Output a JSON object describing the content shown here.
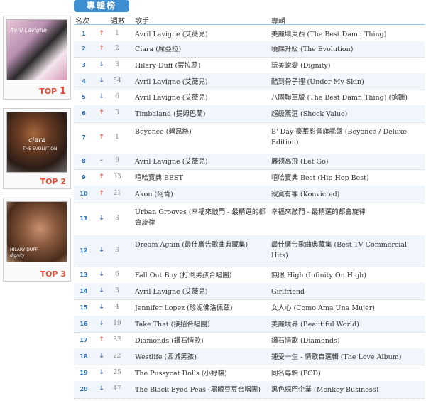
{
  "title": "專輯榜",
  "header": {
    "rank": "名次",
    "weeks": "週數",
    "artist": "歌手",
    "album": "專輯"
  },
  "sidebar": [
    {
      "cover_name": "Avril Lavigne",
      "top_label": "TOP",
      "top_num": "1"
    },
    {
      "cover_name": "ciara",
      "cover_sub": "THE EVOLUTION",
      "top_label": "TOP",
      "top_num": "2"
    },
    {
      "cover_name": "HILARY DUFF",
      "cover_sub": "dignity",
      "top_label": "TOP",
      "top_num": "3"
    }
  ],
  "arrows": {
    "up": "↑",
    "down": "↓",
    "same": "-"
  },
  "rows": [
    {
      "rank": "1",
      "move": "up",
      "weeks": "1",
      "artist": "Avril Lavigne (艾薇兒)",
      "album": "美麗壞東西 (The Best Damn Thing)"
    },
    {
      "rank": "2",
      "move": "up",
      "weeks": "2",
      "artist": "Ciara (席亞拉)",
      "album": "曉課升級 (The Evolution)"
    },
    {
      "rank": "3",
      "move": "down",
      "weeks": "3",
      "artist": "Hilary Duff (蒂拉蕊)",
      "album": "玩美蛻變 (Dignity)"
    },
    {
      "rank": "4",
      "move": "down",
      "weeks": "54",
      "artist": "Avril Lavigne (艾薇兒)",
      "album": "酷到骨子裡 (Under My Skin)"
    },
    {
      "rank": "5",
      "move": "down",
      "weeks": "6",
      "artist": "Avril Lavigne (艾薇兒)",
      "album": "八國聯軍版 (The Best Damn Thing) (搶聽)"
    },
    {
      "rank": "6",
      "move": "up",
      "weeks": "3",
      "artist": "Timbaland (提姆巴蘭)",
      "album": "超級驚選 (Shock Value)"
    },
    {
      "rank": "7",
      "move": "up",
      "weeks": "1",
      "artist": "Beyonce (碧昂絲)",
      "album": "B' Day 豪華影音旗艦盤 (Beyonce / Deluxe Edition)"
    },
    {
      "rank": "8",
      "move": "same",
      "weeks": "9",
      "artist": "Avril Lavigne (艾薇兒)",
      "album": "展翅高飛 (Let Go)"
    },
    {
      "rank": "9",
      "move": "up",
      "weeks": "33",
      "artist": "嘻哈寶典 BEST",
      "album": "嘻哈寶典 Best (Hip Hop Best)"
    },
    {
      "rank": "10",
      "move": "up",
      "weeks": "21",
      "artist": "Akon (阿肯)",
      "album": "寂寞有罪 (Konvicted)"
    },
    {
      "rank": "11",
      "move": "down",
      "weeks": "3",
      "artist": "Urban Grooves (幸福來敲門 - 最精選的都會旋律",
      "album": "幸福來敲門 - 最精選的都會旋律"
    },
    {
      "rank": "12",
      "move": "down",
      "weeks": "3",
      "artist": "Dream Again (最佳廣告歌曲典藏集)",
      "album": "最佳廣告歌曲典藏集 (Best TV Commercial Hits)"
    },
    {
      "rank": "13",
      "move": "down",
      "weeks": "6",
      "artist": "Fall Out Boy (打倒男孩合唱團)",
      "album": "無限 High (Infinity On High)"
    },
    {
      "rank": "14",
      "move": "down",
      "weeks": "3",
      "artist": "Avril Lavigne (艾薇兒)",
      "album": "Girlfriend"
    },
    {
      "rank": "15",
      "move": "down",
      "weeks": "4",
      "artist": "Jennifer Lopez (珍妮佛洛佩茲)",
      "album": "女人心 (Como Ama Una Mujer)"
    },
    {
      "rank": "16",
      "move": "down",
      "weeks": "19",
      "artist": "Take That (接招合唱團)",
      "album": "美麗境界 (Beautiful World)"
    },
    {
      "rank": "17",
      "move": "up",
      "weeks": "32",
      "artist": "Diamonds (鑽石情歌)",
      "album": "鑽石情歌 (Diamonds)"
    },
    {
      "rank": "18",
      "move": "down",
      "weeks": "22",
      "artist": "Westlife (西城男孩)",
      "album": "鍾愛一生 - 情歌自選輯 (The Love Album)"
    },
    {
      "rank": "19",
      "move": "down",
      "weeks": "25",
      "artist": "The Pussycat Dolls (小野貓)",
      "album": "同名專輯 (PCD)"
    },
    {
      "rank": "20",
      "move": "down",
      "weeks": "47",
      "artist": "The Black Eyed Peas (黑眼豆豆合唱團)",
      "album": "黑色探門企業 (Monkey Business)"
    }
  ]
}
